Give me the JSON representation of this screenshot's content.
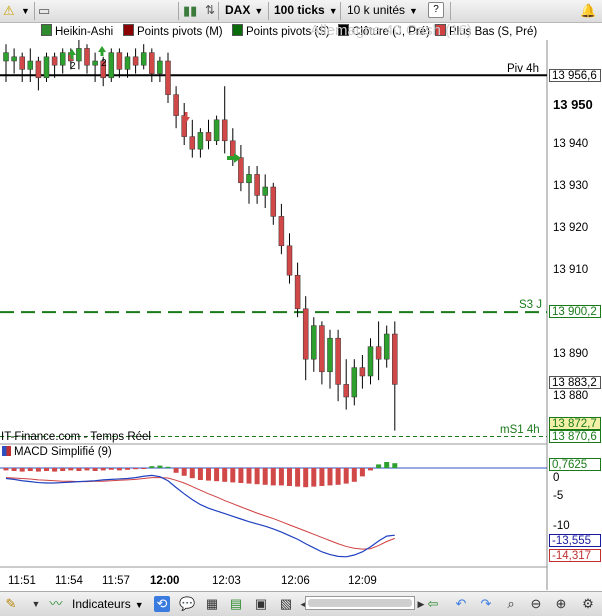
{
  "toolbar": {
    "instrument": "DAX",
    "ticks": "100 ticks",
    "units": "10 k unités",
    "help_icon": "help-icon",
    "alert_icon": "alert-bell-icon"
  },
  "indicator_tabs": [
    {
      "label": "Heikin-Ashi",
      "color": "#2e8b2e"
    },
    {
      "label": "Points pivots (M)",
      "color": "#8b0000"
    },
    {
      "label": "Points pivots (S)",
      "color": "#0a6b0a"
    },
    {
      "label": "Clôture (J, Pré)",
      "color": "#000000"
    },
    {
      "label": "Plus Bas (S, Pré)",
      "color": "#d04040"
    }
  ],
  "watermark": "Allemagne 40 Cash (1€)",
  "price_axis": {
    "ticks": [
      "13 950",
      "13 940",
      "13 930",
      "13 920",
      "13 910",
      "13 890",
      "13 880"
    ],
    "boxes": [
      {
        "text": "13 956,6",
        "color": "#000000"
      },
      {
        "text": "13 900,2",
        "color": "#1a7a1a"
      },
      {
        "text": "13 883,2",
        "color": "#000000"
      },
      {
        "text": "13 872,7",
        "color": "#1a7a1a"
      },
      {
        "text": "13 870,6",
        "color": "#1a7a1a"
      }
    ]
  },
  "levels": {
    "piv4h": "Piv 4h",
    "s3j": "S3 J",
    "ms1_4h": "mS1 4h"
  },
  "chart_markers": {
    "count_a": "2",
    "count_b": "2"
  },
  "source": "IT-Finance.com - Temps Réel",
  "macd": {
    "title": "MACD Simplifié (9)",
    "ticks": [
      "0",
      "-5",
      "-10"
    ],
    "boxes": [
      {
        "text": "0,7625",
        "color": "#1a7a1a"
      },
      {
        "text": "-13,555",
        "color": "#1a1aa0"
      },
      {
        "text": "-14,317",
        "color": "#c03030"
      }
    ]
  },
  "time_axis": [
    "11:51",
    "11:54",
    "11:57",
    "12:00",
    "12:03",
    "12:06",
    "12:09"
  ],
  "bottom": {
    "indicators_label": "Indicateurs"
  },
  "chart_data": {
    "type": "candlestick",
    "candles": [
      {
        "o": 13962,
        "h": 13964,
        "l": 13955,
        "c": 13960,
        "up": true
      },
      {
        "o": 13960,
        "h": 13963,
        "l": 13957,
        "c": 13961,
        "up": true
      },
      {
        "o": 13961,
        "h": 13962,
        "l": 13955,
        "c": 13958,
        "up": false
      },
      {
        "o": 13958,
        "h": 13963,
        "l": 13955,
        "c": 13960,
        "up": true
      },
      {
        "o": 13960,
        "h": 13961,
        "l": 13953,
        "c": 13956,
        "up": false
      },
      {
        "o": 13956,
        "h": 13962,
        "l": 13955,
        "c": 13961,
        "up": true
      },
      {
        "o": 13961,
        "h": 13962,
        "l": 13956,
        "c": 13959,
        "up": false
      },
      {
        "o": 13959,
        "h": 13963,
        "l": 13957,
        "c": 13962,
        "up": true
      },
      {
        "o": 13962,
        "h": 13963,
        "l": 13958,
        "c": 13960,
        "up": false
      },
      {
        "o": 13960,
        "h": 13965,
        "l": 13958,
        "c": 13963,
        "up": true
      },
      {
        "o": 13963,
        "h": 13964,
        "l": 13957,
        "c": 13959,
        "up": false
      },
      {
        "o": 13959,
        "h": 13962,
        "l": 13955,
        "c": 13960,
        "up": true
      },
      {
        "o": 13960,
        "h": 13961,
        "l": 13954,
        "c": 13956,
        "up": false
      },
      {
        "o": 13956,
        "h": 13963,
        "l": 13955,
        "c": 13962,
        "up": true
      },
      {
        "o": 13962,
        "h": 13963,
        "l": 13956,
        "c": 13958,
        "up": false
      },
      {
        "o": 13958,
        "h": 13962,
        "l": 13956,
        "c": 13961,
        "up": true
      },
      {
        "o": 13961,
        "h": 13963,
        "l": 13957,
        "c": 13959,
        "up": false
      },
      {
        "o": 13959,
        "h": 13964,
        "l": 13958,
        "c": 13962,
        "up": true
      },
      {
        "o": 13962,
        "h": 13963,
        "l": 13955,
        "c": 13957,
        "up": false
      },
      {
        "o": 13957,
        "h": 13961,
        "l": 13955,
        "c": 13960,
        "up": true
      },
      {
        "o": 13960,
        "h": 13962,
        "l": 13950,
        "c": 13952,
        "up": false
      },
      {
        "o": 13952,
        "h": 13954,
        "l": 13944,
        "c": 13947,
        "up": false
      },
      {
        "o": 13947,
        "h": 13950,
        "l": 13940,
        "c": 13942,
        "up": false
      },
      {
        "o": 13942,
        "h": 13946,
        "l": 13937,
        "c": 13939,
        "up": false
      },
      {
        "o": 13939,
        "h": 13944,
        "l": 13937,
        "c": 13943,
        "up": true
      },
      {
        "o": 13943,
        "h": 13946,
        "l": 13939,
        "c": 13941,
        "up": false
      },
      {
        "o": 13941,
        "h": 13947,
        "l": 13940,
        "c": 13946,
        "up": true
      },
      {
        "o": 13946,
        "h": 13954,
        "l": 13938,
        "c": 13941,
        "up": false
      },
      {
        "o": 13941,
        "h": 13944,
        "l": 13935,
        "c": 13937,
        "up": false
      },
      {
        "o": 13937,
        "h": 13940,
        "l": 13929,
        "c": 13931,
        "up": false
      },
      {
        "o": 13931,
        "h": 13935,
        "l": 13926,
        "c": 13933,
        "up": true
      },
      {
        "o": 13933,
        "h": 13935,
        "l": 13926,
        "c": 13928,
        "up": false
      },
      {
        "o": 13928,
        "h": 13933,
        "l": 13925,
        "c": 13930,
        "up": true
      },
      {
        "o": 13930,
        "h": 13931,
        "l": 13921,
        "c": 13923,
        "up": false
      },
      {
        "o": 13923,
        "h": 13926,
        "l": 13914,
        "c": 13916,
        "up": false
      },
      {
        "o": 13916,
        "h": 13919,
        "l": 13907,
        "c": 13909,
        "up": false
      },
      {
        "o": 13909,
        "h": 13912,
        "l": 13899,
        "c": 13901,
        "up": false
      },
      {
        "o": 13901,
        "h": 13904,
        "l": 13884,
        "c": 13889,
        "up": false
      },
      {
        "o": 13889,
        "h": 13899,
        "l": 13886,
        "c": 13897,
        "up": true
      },
      {
        "o": 13897,
        "h": 13898,
        "l": 13883,
        "c": 13886,
        "up": false
      },
      {
        "o": 13886,
        "h": 13896,
        "l": 13882,
        "c": 13894,
        "up": true
      },
      {
        "o": 13894,
        "h": 13896,
        "l": 13879,
        "c": 13883,
        "up": false
      },
      {
        "o": 13883,
        "h": 13889,
        "l": 13877,
        "c": 13880,
        "up": false
      },
      {
        "o": 13880,
        "h": 13889,
        "l": 13878,
        "c": 13887,
        "up": true
      },
      {
        "o": 13887,
        "h": 13890,
        "l": 13882,
        "c": 13885,
        "up": false
      },
      {
        "o": 13885,
        "h": 13894,
        "l": 13883,
        "c": 13892,
        "up": true
      },
      {
        "o": 13892,
        "h": 13898,
        "l": 13884,
        "c": 13889,
        "up": false
      },
      {
        "o": 13889,
        "h": 13897,
        "l": 13887,
        "c": 13895,
        "up": true
      },
      {
        "o": 13895,
        "h": 13898,
        "l": 13872,
        "c": 13883,
        "up": false
      }
    ],
    "levels": [
      {
        "name": "Piv 4h",
        "value": 13956.6,
        "style": "solid",
        "color": "#000000"
      },
      {
        "name": "S3 J",
        "value": 13900.2,
        "style": "dash",
        "color": "#1a7a1a"
      },
      {
        "name": "mS1 4h",
        "value": 13870.6,
        "style": "dash",
        "color": "#1a7a1a"
      }
    ],
    "macd_hist": [
      -0.4,
      -0.5,
      -0.6,
      -0.5,
      -0.6,
      -0.5,
      -0.6,
      -0.5,
      -0.4,
      -0.5,
      -0.4,
      -0.5,
      -0.4,
      -0.3,
      -0.4,
      -0.3,
      -0.2,
      -0.1,
      0.3,
      0.4,
      0.2,
      -0.8,
      -1.3,
      -1.7,
      -2.0,
      -2.1,
      -2.2,
      -2.3,
      -2.4,
      -2.5,
      -2.6,
      -2.7,
      -2.8,
      -2.9,
      -2.9,
      -3.0,
      -3.1,
      -3.2,
      -3.1,
      -3.0,
      -2.9,
      -2.8,
      -2.6,
      -2.3,
      -1.4,
      -0.4,
      0.6,
      1.0,
      0.8
    ],
    "macd_line": [
      -1.0,
      -1.2,
      -1.5,
      -1.7,
      -1.9,
      -2.0,
      -2.0,
      -1.9,
      -1.8,
      -1.7,
      -1.6,
      -1.5,
      -1.3,
      -1.2,
      -1.1,
      -1.0,
      -0.8,
      -0.5,
      -0.3,
      -0.6,
      -1.5,
      -3.0,
      -4.4,
      -5.7,
      -6.8,
      -7.6,
      -8.2,
      -8.8,
      -9.4,
      -10.0,
      -10.6,
      -11.1,
      -11.6,
      -12.2,
      -12.9,
      -13.7,
      -14.5,
      -15.5,
      -16.4,
      -17.3,
      -17.9,
      -18.3,
      -18.4,
      -18.0,
      -17.3,
      -16.2,
      -14.9,
      -13.8,
      -13.6
    ],
    "signal_line": [
      -0.8,
      -0.9,
      -1.0,
      -1.1,
      -1.3,
      -1.4,
      -1.5,
      -1.6,
      -1.6,
      -1.7,
      -1.7,
      -1.6,
      -1.6,
      -1.5,
      -1.4,
      -1.3,
      -1.2,
      -1.0,
      -0.8,
      -0.8,
      -0.9,
      -1.4,
      -2.0,
      -2.8,
      -3.6,
      -4.4,
      -5.1,
      -5.9,
      -6.6,
      -7.3,
      -8.0,
      -8.7,
      -9.3,
      -9.9,
      -10.6,
      -11.3,
      -12.0,
      -12.7,
      -13.4,
      -14.1,
      -14.8,
      -15.5,
      -16.1,
      -16.5,
      -16.7,
      -16.6,
      -15.9,
      -15.0,
      -14.3
    ]
  }
}
